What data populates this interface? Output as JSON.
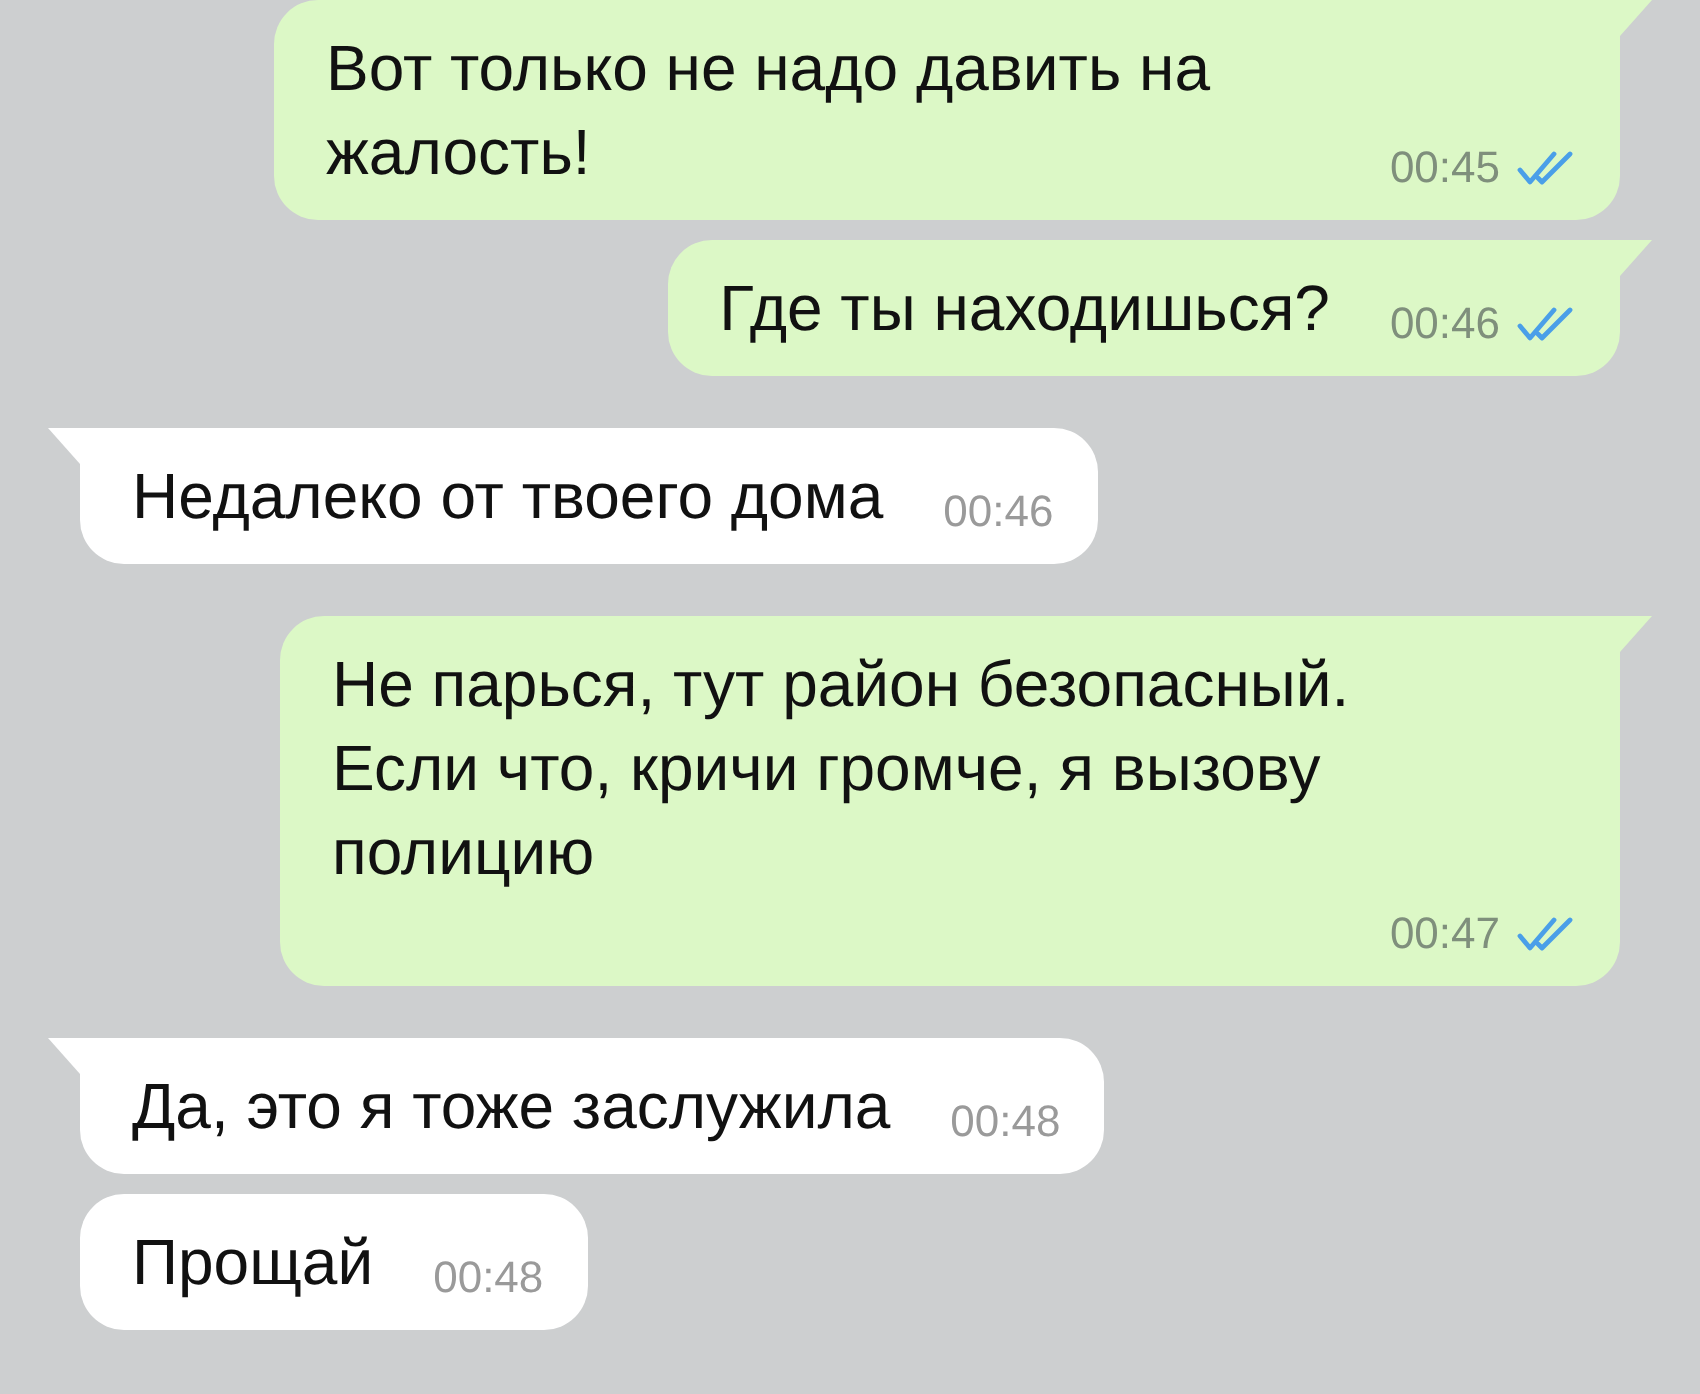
{
  "messages": [
    {
      "kind": "outgoing",
      "tail": true,
      "text": "Вот только не надо давить на жалость!",
      "time": "00:45",
      "read": true
    },
    {
      "kind": "outgoing",
      "tail": true,
      "text": "Где ты находишься?",
      "time": "00:46",
      "read": true
    },
    {
      "kind": "incoming",
      "tail": true,
      "text": "Недалеко от твоего дома",
      "time": "00:46"
    },
    {
      "kind": "outgoing",
      "tail": true,
      "text": "Не парься, тут район безопасный. Если что, кричи громче, я вызову полицию",
      "time": "00:47",
      "read": true
    },
    {
      "kind": "incoming",
      "tail": true,
      "text": "Да, это я тоже заслужила",
      "time": "00:48"
    },
    {
      "kind": "incoming",
      "tail": false,
      "text": "Прощай",
      "time": "00:48"
    }
  ]
}
